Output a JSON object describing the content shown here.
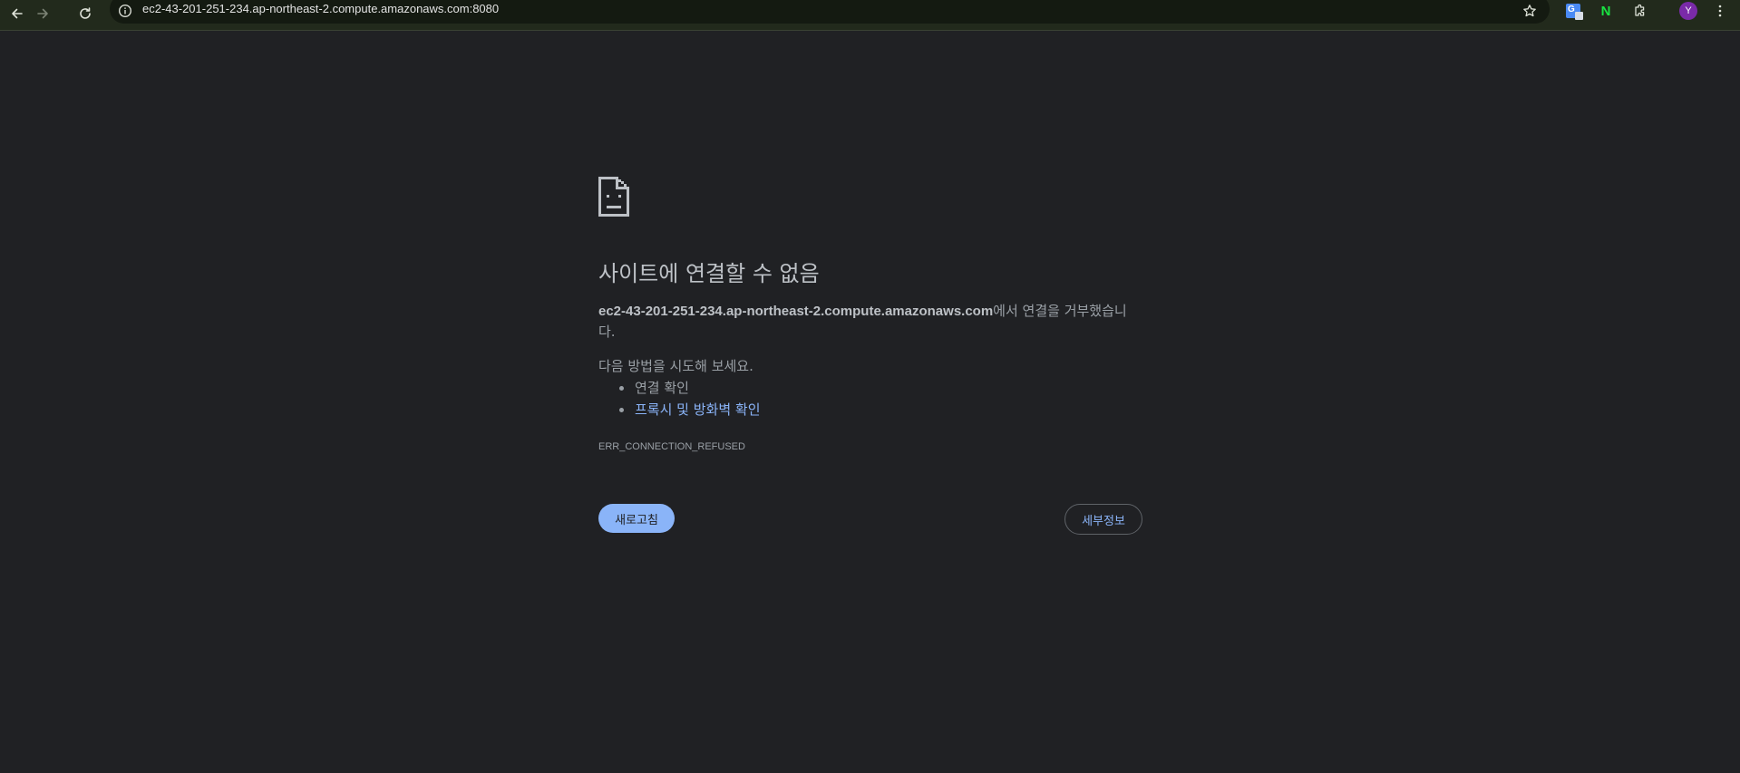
{
  "browser": {
    "url": "ec2-43-201-251-234.ap-northeast-2.compute.amazonaws.com:8080",
    "avatar_letter": "Y",
    "translate_letter": "G",
    "ext_n_letter": "N"
  },
  "error_page": {
    "title": "사이트에 연결할 수 없음",
    "host": "ec2-43-201-251-234.ap-northeast-2.compute.amazonaws.com",
    "refused_text": "에서 연결을 거부했습니다.",
    "suggestions_heading": "다음 방법을 시도해 보세요.",
    "suggestions": [
      "연결 확인",
      "프록시 및 방화벽 확인"
    ],
    "error_code": "ERR_CONNECTION_REFUSED",
    "reload_label": "새로고침",
    "details_label": "세부정보"
  },
  "colors": {
    "background": "#202124",
    "toolbar": "#222a1c",
    "link": "#8ab4f8",
    "text": "#9aa0a6",
    "heading": "#bdc1c6"
  }
}
